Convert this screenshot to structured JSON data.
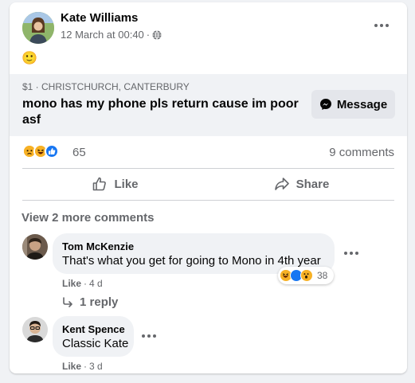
{
  "post": {
    "author": "Kate Williams",
    "timestamp": "12 March at 00:40",
    "separator": "·",
    "emoji": "🙂",
    "listing": {
      "meta": "$1 · CHRISTCHURCH, CANTERBURY",
      "title": "mono has my phone pls return cause im poor asf",
      "message_label": "Message"
    },
    "reactions": {
      "count": "65",
      "types": [
        "sad-icon",
        "haha-icon",
        "like-icon"
      ]
    },
    "comments_count_label": "9 comments",
    "actions": {
      "like_label": "Like",
      "share_label": "Share"
    }
  },
  "comments": {
    "view_more_label": "View 2 more comments",
    "items": [
      {
        "author": "Tom McKenzie",
        "text": "That's what you get for going to Mono in 4th year",
        "like_label": "Like",
        "time": "4 d",
        "reaction_count": "38",
        "reply_label": "1 reply"
      },
      {
        "author": "Kent Spence",
        "text": "Classic Kate",
        "like_label": "Like",
        "time": "3 d"
      }
    ]
  },
  "colors": {
    "accent": "#1877f2",
    "muted": "#65676b",
    "bubble": "#f0f2f5",
    "like_blue": "#1877f2",
    "haha_yellow": "#f7b125"
  }
}
